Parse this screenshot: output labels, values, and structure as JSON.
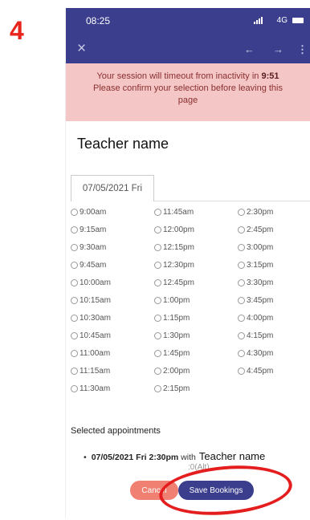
{
  "step": {
    "number": "4"
  },
  "status_bar": {
    "time": "08:25",
    "network": "4G"
  },
  "alert": {
    "line1_prefix": "Your session will timeout from inactivity in ",
    "countdown": "9:51",
    "line2": "Please confirm your selection before leaving this",
    "line3": "page"
  },
  "teacher_name": "Teacher name",
  "date_tab": "07/05/2021 Fri",
  "time_slots": {
    "col1": [
      "9:00am",
      "9:15am",
      "9:30am",
      "9:45am",
      "10:00am",
      "10:15am",
      "10:30am",
      "10:45am",
      "11:00am",
      "11:15am",
      "11:30am"
    ],
    "col2": [
      "11:45am",
      "12:00pm",
      "12:15pm",
      "12:30pm",
      "12:45pm",
      "1:00pm",
      "1:15pm",
      "1:30pm",
      "1:45pm",
      "2:00pm",
      "2:15pm"
    ],
    "col3": [
      "2:30pm",
      "2:45pm",
      "3:00pm",
      "3:15pm",
      "3:30pm",
      "3:45pm",
      "4:00pm",
      "4:15pm",
      "4:30pm",
      "4:45pm"
    ]
  },
  "selected": {
    "title": "Selected appointments",
    "bullet": "•",
    "datetime": "07/05/2021 Fri 2:30pm",
    "with": " with",
    "teacher": "Teacher name",
    "sub": ":0(Alt)"
  },
  "buttons": {
    "cancel": "Cancel",
    "save": "Save Bookings"
  },
  "colors": {
    "header": "#3a3e8c",
    "alert_bg": "#f4c6c6",
    "cancel": "#f08072",
    "save": "#3a3e8c",
    "annotation": "#e41e1e"
  },
  "icons": {
    "close": "close-icon",
    "back": "arrow-left-icon",
    "forward": "arrow-right-icon",
    "menu": "more-vertical-icon",
    "radio": "radio-unchecked-icon"
  }
}
